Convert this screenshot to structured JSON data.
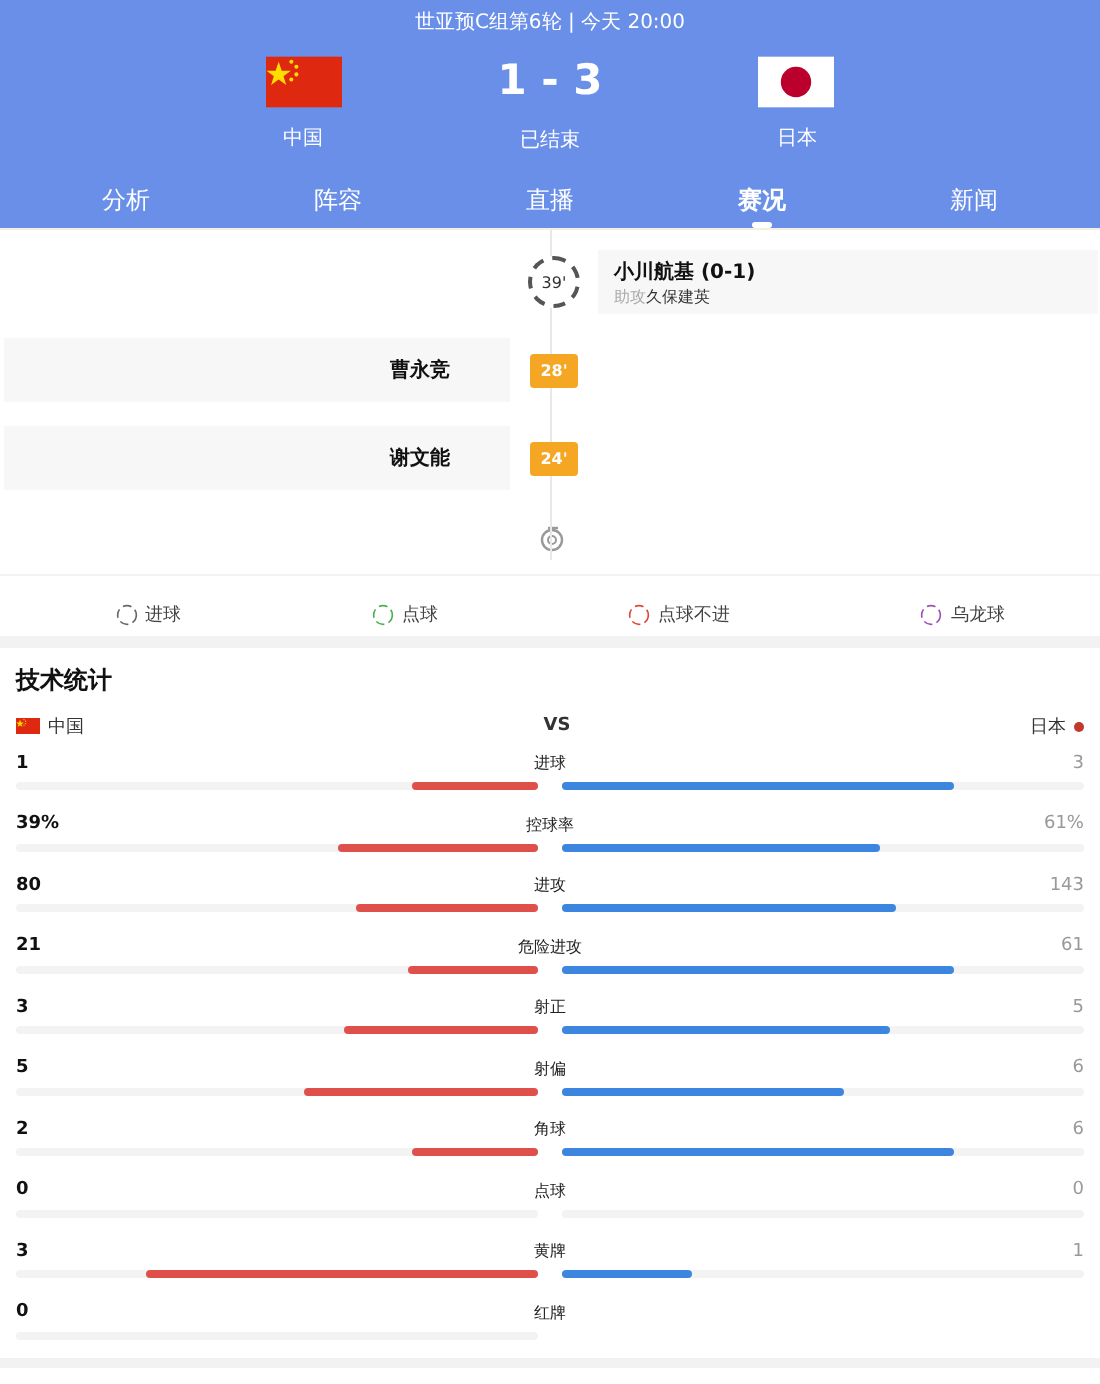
{
  "header": {
    "title": "世亚预C组第6轮 | 今天 20:00",
    "home": {
      "name": "中国",
      "kind": "china"
    },
    "away": {
      "name": "日本",
      "kind": "japan"
    },
    "score": "1 - 3",
    "status": "已结束"
  },
  "tabs": [
    {
      "label": "分析",
      "selected": false
    },
    {
      "label": "阵容",
      "selected": false
    },
    {
      "label": "直播",
      "selected": false
    },
    {
      "label": "赛况",
      "selected": true
    },
    {
      "label": "新闻",
      "selected": false
    }
  ],
  "timeline": [
    {
      "kind": "goal",
      "minute": "39'",
      "away": {
        "player": "小川航基 (0-1)",
        "assist_label": "助攻",
        "assist": "久保建英"
      }
    },
    {
      "kind": "card",
      "minute": "28'",
      "home": {
        "player": "曹永竞"
      }
    },
    {
      "kind": "card",
      "minute": "24'",
      "home": {
        "player": "谢文能"
      }
    }
  ],
  "legend": [
    {
      "label": "进球",
      "color": "#666666"
    },
    {
      "label": "点球",
      "color": "#4caf50"
    },
    {
      "label": "点球不进",
      "color": "#e0453a"
    },
    {
      "label": "乌龙球",
      "color": "#9c4fb5"
    }
  ],
  "stats": {
    "title": "技术统计",
    "home": "中国",
    "vs": "VS",
    "away": "日本",
    "rows": [
      {
        "label": "进球",
        "home": {
          "value": "1",
          "level": 0.24
        },
        "away": {
          "value": "3",
          "level": 0.75
        }
      },
      {
        "label": "控球率",
        "home": {
          "value": "39%",
          "level": 0.385
        },
        "away": {
          "value": "61%",
          "level": 0.61
        }
      },
      {
        "label": "进攻",
        "home": {
          "value": "80",
          "level": 0.35
        },
        "away": {
          "value": "143",
          "level": 0.64
        }
      },
      {
        "label": "危险进攻",
        "home": {
          "value": "21",
          "level": 0.25
        },
        "away": {
          "value": "61",
          "level": 0.75
        }
      },
      {
        "label": "射正",
        "home": {
          "value": "3",
          "level": 0.37
        },
        "away": {
          "value": "5",
          "level": 0.63
        }
      },
      {
        "label": "射偏",
        "home": {
          "value": "5",
          "level": 0.45
        },
        "away": {
          "value": "6",
          "level": 0.54
        }
      },
      {
        "label": "角球",
        "home": {
          "value": "2",
          "level": 0.24
        },
        "away": {
          "value": "6",
          "level": 0.75
        }
      },
      {
        "label": "点球",
        "home": {
          "value": "0",
          "level": 0
        },
        "away": {
          "value": "0",
          "level": 0
        }
      },
      {
        "label": "黄牌",
        "home": {
          "value": "3",
          "level": 0.75
        },
        "away": {
          "value": "1",
          "level": 0.25
        }
      },
      {
        "label": "红牌",
        "home": {
          "value": "0",
          "level": 0
        }
      }
    ]
  }
}
